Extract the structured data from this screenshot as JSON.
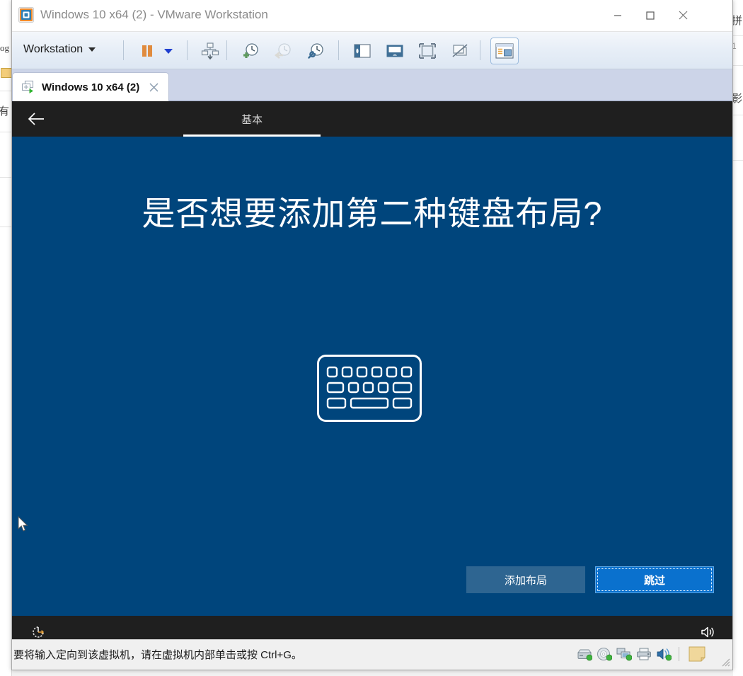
{
  "background": {
    "left_text": "og",
    "left_char": "有",
    "right_chars": [
      "拼",
      "1",
      "影"
    ]
  },
  "window": {
    "title": "Windows 10 x64 (2) - VMware Workstation",
    "logo_icon": "vmware-logo-icon",
    "controls": {
      "minimize": "minimize-button",
      "maximize": "maximize-button",
      "close": "close-button"
    }
  },
  "toolbar": {
    "menu_label": "Workstation",
    "menu_caret": "chevron-down-icon",
    "buttons": [
      {
        "name": "suspend-vm-button",
        "icon": "pause-icon"
      },
      {
        "name": "power-options-dropdown",
        "icon": "chevron-down-icon"
      },
      {
        "name": "manage-vm-button",
        "icon": "vm-manage-icon"
      },
      {
        "name": "take-snapshot-button",
        "icon": "snapshot-add-icon"
      },
      {
        "name": "revert-snapshot-button",
        "icon": "snapshot-revert-icon"
      },
      {
        "name": "snapshot-manager-button",
        "icon": "snapshot-manager-icon"
      },
      {
        "name": "show-library-button",
        "icon": "sidebar-panel-icon"
      },
      {
        "name": "show-thumbnail-bar-button",
        "icon": "thumbnail-bar-icon"
      },
      {
        "name": "full-screen-button",
        "icon": "fullscreen-icon"
      },
      {
        "name": "unity-mode-button",
        "icon": "unity-mode-icon"
      },
      {
        "name": "console-view-button",
        "icon": "console-view-icon"
      }
    ]
  },
  "tabstrip": {
    "tab_label": "Windows 10 x64 (2)",
    "tab_icon": "vm-running-icon",
    "close_icon": "close-icon"
  },
  "oobe": {
    "back_icon": "back-arrow-icon",
    "tab_label": "基本",
    "heading": "是否想要添加第二种键盘布局?",
    "illustration": "keyboard-icon",
    "buttons": {
      "secondary_label": "添加布局",
      "primary_label": "跳过"
    },
    "footer": {
      "ease_of_access_icon": "ease-of-access-icon",
      "volume_icon": "speaker-icon"
    },
    "colors": {
      "background": "#00457c",
      "header": "#1f1f1f",
      "primary_button": "#0a71ce",
      "secondary_button": "#2e6591"
    }
  },
  "statusbar": {
    "message": "要将输入定向到该虚拟机，请在虚拟机内部单击或按 Ctrl+G。",
    "icons": [
      "hard-disk-icon",
      "cd-dvd-icon",
      "network-adapter-icon",
      "printer-icon",
      "sound-card-icon",
      "notes-icon"
    ]
  }
}
